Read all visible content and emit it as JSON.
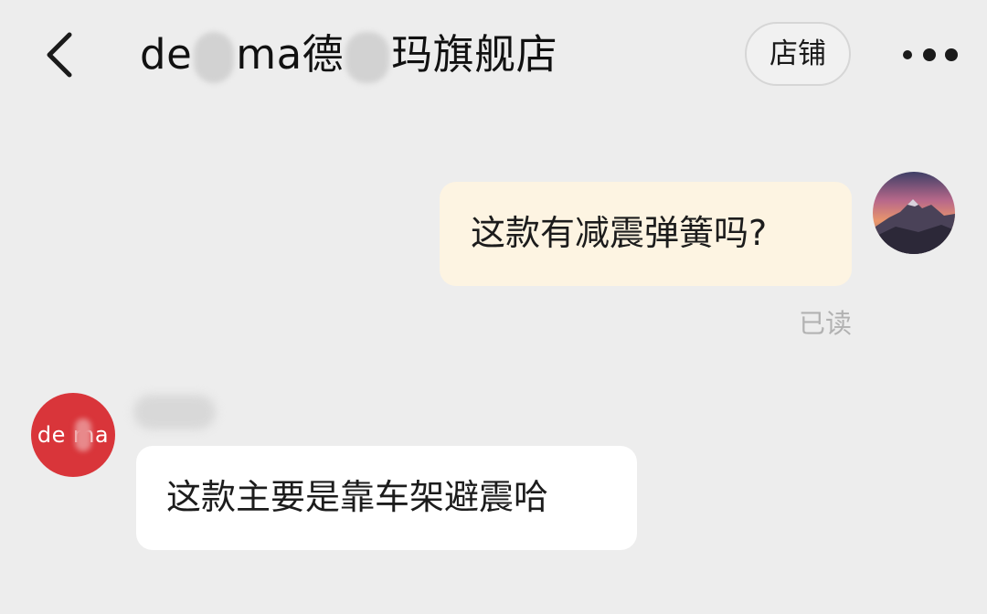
{
  "header": {
    "back_icon": "chevron-left-icon",
    "title_prefix": "de",
    "title_middle": "ma德",
    "title_suffix": "玛旗舰店",
    "shop_button_label": "店铺",
    "more_icon": "more-dots-icon"
  },
  "messages": [
    {
      "direction": "outgoing",
      "text": "这款有减震弹簧吗?",
      "status": "已读",
      "avatar_icon": "mountain-sunset-avatar"
    },
    {
      "direction": "incoming",
      "sender_logo": "de ma",
      "text": "这款主要是靠车架避震哈",
      "avatar_color": "#d9353a"
    }
  ],
  "colors": {
    "background": "#ededed",
    "outgoing_bubble": "#fdf4e2",
    "incoming_bubble": "#ffffff",
    "read_receipt": "#b2b2b2",
    "shop_avatar": "#d9353a"
  }
}
